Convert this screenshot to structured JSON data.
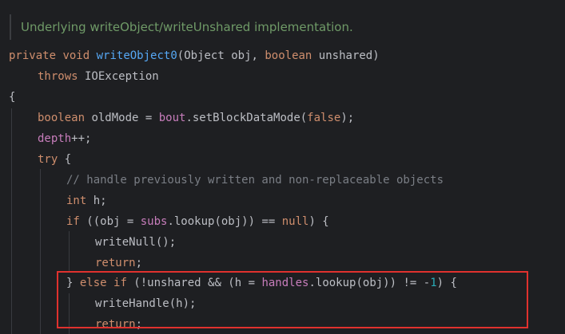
{
  "doc_comment": "Underlying writeObject/writeUnshared implementation.",
  "code": {
    "l1": {
      "kw_private": "private",
      "kw_void": "void",
      "method_name": "writeObject0",
      "open_paren": "(",
      "param1_type": "Object",
      "param1_name": " obj, ",
      "kw_boolean": "boolean",
      "param2_name": " unshared)"
    },
    "l2": {
      "kw_throws": "throws",
      "exception": " IOException"
    },
    "l3": {
      "brace_open": "{"
    },
    "l4": {
      "kw_boolean": "boolean",
      "var_decl": " oldMode = ",
      "field_bout": "bout",
      "call": ".setBlockDataMode(",
      "kw_false": "false",
      "end": ");"
    },
    "l5": {
      "field_depth": "depth",
      "end": "++;"
    },
    "l6": {
      "kw_try": "try",
      "end": " {"
    },
    "l7": {
      "comment": "// handle previously written and non-replaceable objects"
    },
    "l8": {
      "kw_int": "int",
      "end": " h;"
    },
    "l9": {
      "kw_if": "if",
      "p1": " ((obj = ",
      "field_subs": "subs",
      "p2": ".lookup(obj)) == ",
      "kw_null": "null",
      "p3": ") {"
    },
    "l10": {
      "call": "writeNull();"
    },
    "l11": {
      "kw_return": "return",
      "end": ";"
    },
    "l12": {
      "brace": "} ",
      "kw_else": "else",
      "kw_if": "if",
      "p1": " (!unshared && (h = ",
      "field_handles": "handles",
      "p2": ".lookup(obj)) != -",
      "num_one": "1",
      "p3": ") {"
    },
    "l13": {
      "call": "writeHandle(h);"
    },
    "l14": {
      "kw_return": "return",
      "end": ";"
    }
  },
  "colors": {
    "background": "#1e1f22",
    "text": "#bcbec4",
    "keyword": "#cf8e6d",
    "function_name": "#56a8f5",
    "field": "#c77dbb",
    "number": "#2aacb8",
    "comment": "#7a7e85",
    "doc_comment": "#6f9a67",
    "highlight_border": "#e0312e"
  }
}
